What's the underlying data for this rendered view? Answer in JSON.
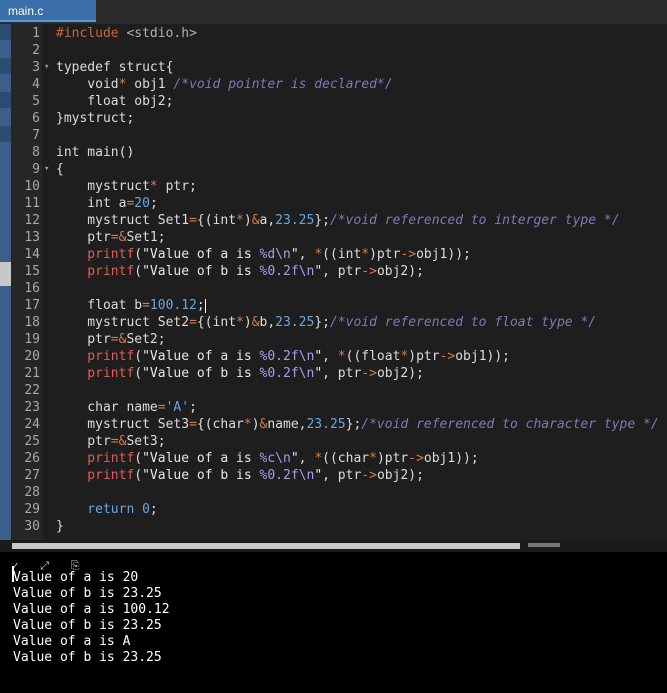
{
  "tab": {
    "label": "main.c"
  },
  "editor": {
    "lines": [
      {
        "n": "1",
        "fold": "",
        "segs": [
          [
            "inc",
            "#include "
          ],
          [
            "hdr",
            "<stdio.h>"
          ]
        ]
      },
      {
        "n": "2",
        "fold": "",
        "segs": []
      },
      {
        "n": "3",
        "fold": "▾",
        "segs": [
          [
            "kw",
            "typedef struct{"
          ]
        ]
      },
      {
        "n": "4",
        "fold": "",
        "segs": [
          [
            "kw",
            "    void"
          ],
          [
            "op",
            "*"
          ],
          [
            "kw",
            " obj1 "
          ],
          [
            "cm",
            "/*void pointer is declared*/"
          ]
        ]
      },
      {
        "n": "5",
        "fold": "",
        "segs": [
          [
            "kw",
            "    float obj2;"
          ]
        ]
      },
      {
        "n": "6",
        "fold": "",
        "segs": [
          [
            "kw",
            "}mystruct;"
          ]
        ]
      },
      {
        "n": "7",
        "fold": "",
        "segs": []
      },
      {
        "n": "8",
        "fold": "",
        "segs": [
          [
            "kw",
            "int main()"
          ]
        ]
      },
      {
        "n": "9",
        "fold": "▾",
        "segs": [
          [
            "kw",
            "{"
          ]
        ]
      },
      {
        "n": "10",
        "fold": "",
        "segs": [
          [
            "kw",
            "    mystruct"
          ],
          [
            "op",
            "*"
          ],
          [
            "kw",
            " ptr;"
          ]
        ]
      },
      {
        "n": "11",
        "fold": "",
        "segs": [
          [
            "kw",
            "    int a"
          ],
          [
            "op",
            "="
          ],
          [
            "num",
            "20"
          ],
          [
            "kw",
            ";"
          ]
        ]
      },
      {
        "n": "12",
        "fold": "",
        "segs": [
          [
            "kw",
            "    mystruct Set1"
          ],
          [
            "op",
            "="
          ],
          [
            "kw",
            "{(int"
          ],
          [
            "op",
            "*"
          ],
          [
            "kw",
            ")"
          ],
          [
            "op",
            "&"
          ],
          [
            "kw",
            "a,"
          ],
          [
            "num",
            "23.25"
          ],
          [
            "kw",
            "};"
          ],
          [
            "cm",
            "/*void referenced to interger type */"
          ]
        ]
      },
      {
        "n": "13",
        "fold": "",
        "segs": [
          [
            "kw",
            "    ptr"
          ],
          [
            "op",
            "=&"
          ],
          [
            "kw",
            "Set1;"
          ]
        ]
      },
      {
        "n": "14",
        "fold": "",
        "segs": [
          [
            "fn",
            "    printf"
          ],
          [
            "kw",
            "("
          ],
          [
            "str",
            "\"Value of a is "
          ],
          [
            "esc",
            "%d\\n"
          ],
          [
            "str",
            "\""
          ],
          [
            "kw",
            ", "
          ],
          [
            "op",
            "*"
          ],
          [
            "kw",
            "((int"
          ],
          [
            "op",
            "*"
          ],
          [
            "kw",
            ")ptr"
          ],
          [
            "op",
            "->"
          ],
          [
            "kw",
            "obj1));"
          ]
        ]
      },
      {
        "n": "15",
        "fold": "",
        "segs": [
          [
            "fn",
            "    printf"
          ],
          [
            "kw",
            "("
          ],
          [
            "str",
            "\"Value of b is "
          ],
          [
            "esc",
            "%0.2f\\n"
          ],
          [
            "str",
            "\""
          ],
          [
            "kw",
            ", ptr"
          ],
          [
            "op",
            "->"
          ],
          [
            "kw",
            "obj2);"
          ]
        ]
      },
      {
        "n": "16",
        "fold": "",
        "segs": []
      },
      {
        "n": "17",
        "fold": "",
        "segs": [
          [
            "kw",
            "    float b"
          ],
          [
            "op",
            "="
          ],
          [
            "num",
            "100.12"
          ],
          [
            "kw",
            ";"
          ],
          [
            "cursor",
            ""
          ]
        ]
      },
      {
        "n": "18",
        "fold": "",
        "segs": [
          [
            "kw",
            "    mystruct Set2"
          ],
          [
            "op",
            "="
          ],
          [
            "kw",
            "{(int"
          ],
          [
            "op",
            "*"
          ],
          [
            "kw",
            ")"
          ],
          [
            "op",
            "&"
          ],
          [
            "kw",
            "b,"
          ],
          [
            "num",
            "23.25"
          ],
          [
            "kw",
            "};"
          ],
          [
            "cm",
            "/*void referenced to float type */"
          ]
        ]
      },
      {
        "n": "19",
        "fold": "",
        "segs": [
          [
            "kw",
            "    ptr"
          ],
          [
            "op",
            "=&"
          ],
          [
            "kw",
            "Set2;"
          ]
        ]
      },
      {
        "n": "20",
        "fold": "",
        "segs": [
          [
            "fn",
            "    printf"
          ],
          [
            "kw",
            "("
          ],
          [
            "str",
            "\"Value of a is "
          ],
          [
            "esc",
            "%0.2f\\n"
          ],
          [
            "str",
            "\""
          ],
          [
            "kw",
            ", "
          ],
          [
            "op",
            "*"
          ],
          [
            "kw",
            "((float"
          ],
          [
            "op",
            "*"
          ],
          [
            "kw",
            ")ptr"
          ],
          [
            "op",
            "->"
          ],
          [
            "kw",
            "obj1));"
          ]
        ]
      },
      {
        "n": "21",
        "fold": "",
        "segs": [
          [
            "fn",
            "    printf"
          ],
          [
            "kw",
            "("
          ],
          [
            "str",
            "\"Value of b is "
          ],
          [
            "esc",
            "%0.2f\\n"
          ],
          [
            "str",
            "\""
          ],
          [
            "kw",
            ", ptr"
          ],
          [
            "op",
            "->"
          ],
          [
            "kw",
            "obj2);"
          ]
        ]
      },
      {
        "n": "22",
        "fold": "",
        "segs": []
      },
      {
        "n": "23",
        "fold": "",
        "segs": [
          [
            "kw",
            "    char name"
          ],
          [
            "op",
            "="
          ],
          [
            "num",
            "'A'"
          ],
          [
            "kw",
            ";"
          ]
        ]
      },
      {
        "n": "24",
        "fold": "",
        "segs": [
          [
            "kw",
            "    mystruct Set3"
          ],
          [
            "op",
            "="
          ],
          [
            "kw",
            "{(char"
          ],
          [
            "op",
            "*"
          ],
          [
            "kw",
            ")"
          ],
          [
            "op",
            "&"
          ],
          [
            "kw",
            "name,"
          ],
          [
            "num",
            "23.25"
          ],
          [
            "kw",
            "};"
          ],
          [
            "cm",
            "/*void referenced to character type */"
          ]
        ]
      },
      {
        "n": "25",
        "fold": "",
        "segs": [
          [
            "kw",
            "    ptr"
          ],
          [
            "op",
            "=&"
          ],
          [
            "kw",
            "Set3;"
          ]
        ]
      },
      {
        "n": "26",
        "fold": "",
        "segs": [
          [
            "fn",
            "    printf"
          ],
          [
            "kw",
            "("
          ],
          [
            "str",
            "\"Value of a is "
          ],
          [
            "esc",
            "%c\\n"
          ],
          [
            "str",
            "\""
          ],
          [
            "kw",
            ", "
          ],
          [
            "op",
            "*"
          ],
          [
            "kw",
            "((char"
          ],
          [
            "op",
            "*"
          ],
          [
            "kw",
            ")ptr"
          ],
          [
            "op",
            "->"
          ],
          [
            "kw",
            "obj1));"
          ]
        ]
      },
      {
        "n": "27",
        "fold": "",
        "segs": [
          [
            "fn",
            "    printf"
          ],
          [
            "kw",
            "("
          ],
          [
            "str",
            "\"Value of b is "
          ],
          [
            "esc",
            "%0.2f\\n"
          ],
          [
            "str",
            "\""
          ],
          [
            "kw",
            ", ptr"
          ],
          [
            "op",
            "->"
          ],
          [
            "kw",
            "obj2);"
          ]
        ]
      },
      {
        "n": "28",
        "fold": "",
        "segs": []
      },
      {
        "n": "29",
        "fold": "",
        "segs": [
          [
            "num",
            "    return 0"
          ],
          [
            "kw",
            ";"
          ]
        ]
      },
      {
        "n": "30",
        "fold": "",
        "segs": [
          [
            "kw",
            "}"
          ]
        ]
      }
    ]
  },
  "console": {
    "toolbar_icons": [
      "checkmark-icon",
      "expand-icon",
      "copy-icon"
    ],
    "toolbar_glyphs": [
      "✓",
      "⤢",
      "⎘"
    ],
    "output": [
      "Value of a is 20",
      "Value of b is 23.25",
      "Value of a is 100.12",
      "Value of b is 23.25",
      "Value of a is A",
      "Value of b is 23.25"
    ]
  },
  "colors": {
    "tab_active": "#3a6ea8",
    "editor_bg": "#1e1e1e",
    "console_bg": "#000000",
    "comment": "#7a7ab8",
    "function": "#e35b5b",
    "number": "#6aa6e0"
  }
}
